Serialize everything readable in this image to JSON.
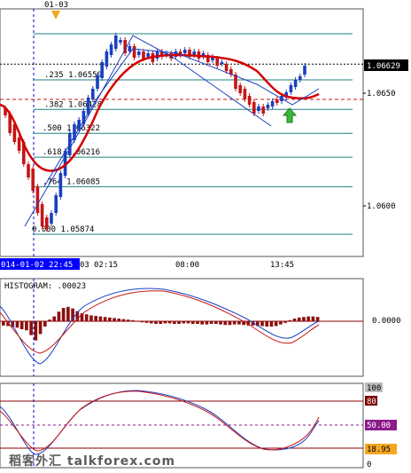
{
  "header": {
    "date_marker": "01-03"
  },
  "main_panel": {
    "price_current": "1.06629",
    "price_ticks": [
      "1.0650",
      "1.0600"
    ],
    "fib_levels": [
      {
        "ratio": ".235",
        "price": "1.06559"
      },
      {
        "ratio": ".382",
        "price": "1.06428"
      },
      {
        "ratio": ".500",
        "price": "1.06322"
      },
      {
        "ratio": ".618",
        "price": "1.06216"
      },
      {
        "ratio": ".764",
        "price": "1.06085"
      },
      {
        "ratio": "0.000",
        "price": "1.05874"
      }
    ]
  },
  "time_axis": {
    "highlight": "014-01-02 22:45",
    "labels": [
      "03",
      "02:15",
      "08:00",
      "13:45"
    ]
  },
  "histogram": {
    "title": "HISTOGRAM: .00023",
    "zero_label": "0.0000",
    "values": [
      -0.8,
      -0.9,
      -1.1,
      -1.2,
      -1.5,
      -1.7,
      -2.6,
      -3.6,
      -2.4,
      -1.0,
      0.3,
      0.9,
      1.8,
      2.5,
      2.7,
      2.4,
      1.9,
      1.5,
      1.3,
      1.1,
      1.0,
      0.9,
      0.8,
      0.7,
      0.6,
      0.5,
      0.4,
      0.3,
      0.2,
      0.1,
      -0.2,
      -0.3,
      -0.4,
      -0.5,
      -0.5,
      -0.4,
      -0.4,
      -0.5,
      -0.5,
      -0.4,
      -0.4,
      -0.5,
      -0.5,
      -0.6,
      -0.6,
      -0.5,
      -0.5,
      -0.6,
      -0.7,
      -0.7,
      -0.6,
      -0.6,
      -0.7,
      -0.8,
      -0.8,
      -0.9,
      -0.9,
      -1.0,
      -1.0,
      -0.9,
      -0.6,
      -0.3,
      0.2,
      0.5,
      0.7,
      0.8,
      0.9,
      0.9,
      0.8
    ]
  },
  "stochastic": {
    "levels": [
      "100",
      "80",
      "50.00",
      "18.95",
      "0"
    ],
    "colors": {
      "level_50": "#8b1a8b",
      "level_18": "#f5a623"
    }
  },
  "watermark": "稻客外汇 talkforex.com",
  "colors": {
    "bull": "#1a3fbf",
    "bear": "#c81414",
    "ma": "#d40000",
    "fib": "#208080",
    "axis_highlight": "#0000ff"
  }
}
